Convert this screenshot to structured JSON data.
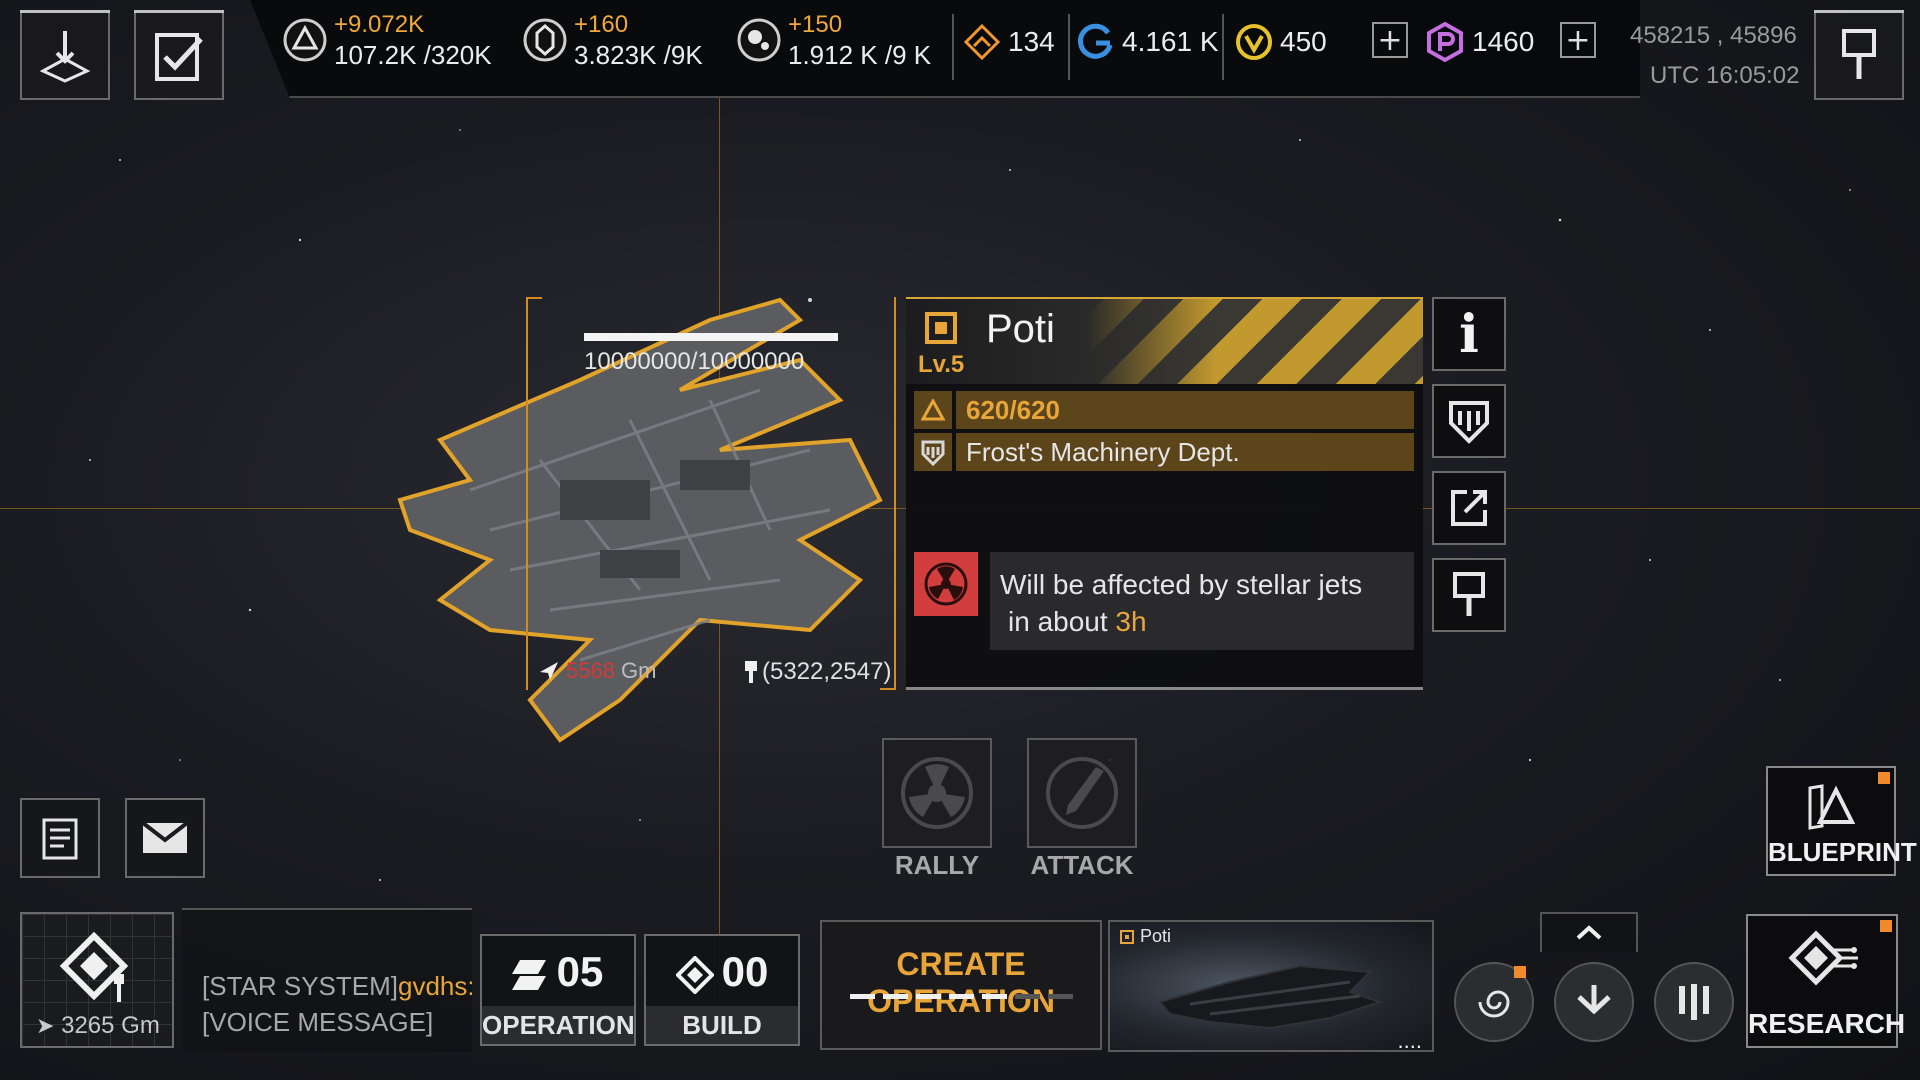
{
  "header": {
    "resources": [
      {
        "icon": "metal-icon",
        "delta": "+9.072K",
        "amount": "107.2K /320K"
      },
      {
        "icon": "crystal-icon",
        "delta": "+160",
        "amount": "3.823K /9K"
      },
      {
        "icon": "deuterium-icon",
        "delta": "+150",
        "amount": "1.912 K /9 K"
      }
    ],
    "currencies": [
      {
        "icon": "energy-icon",
        "value": "134"
      },
      {
        "icon": "cycle-icon",
        "value": "4.161 K"
      },
      {
        "icon": "coin-icon",
        "value": "450"
      },
      {
        "icon": "premium-icon",
        "value": "1460"
      }
    ],
    "add_symbol": "+",
    "coords": "458215 , 45896",
    "time": "UTC 16:05:02"
  },
  "target": {
    "hp": "10000000/10000000",
    "distance": "5568",
    "distance_unit": "Gm",
    "location": "(5322,2547)"
  },
  "panel": {
    "name": "Poti",
    "level": "Lv.5",
    "durability": "620/620",
    "owner": "Frost's Machinery Dept.",
    "warning_text": "Will be affected by stellar jets",
    "warning_prefix": "in about ",
    "warning_time": "3h",
    "side_buttons": [
      "info-icon",
      "guild-icon",
      "share-icon",
      "bookmark-icon"
    ],
    "info_symbol": "i"
  },
  "actions": {
    "rally": "RALLY",
    "attack": "ATTACK"
  },
  "left_buttons": [
    "notes-icon",
    "mail-icon"
  ],
  "blueprint": {
    "label": "BLUEPRINT"
  },
  "bottom": {
    "minimap_distance": "3265 Gm",
    "chat_prefix": "[STAR SYSTEM]",
    "chat_name": "gvdhs:",
    "chat_line2": "[VOICE MESSAGE]",
    "operation_count": "05",
    "operation_label": "OPERATION",
    "build_count": "00",
    "build_label": "BUILD",
    "create_label": "CREATE OPERATION",
    "preview_name": "Poti",
    "research_label": "RESEARCH",
    "more_dots": "...."
  },
  "colors": {
    "accent": "#e8a53a",
    "frame": "#d68a22",
    "warning": "#d23d3d"
  }
}
